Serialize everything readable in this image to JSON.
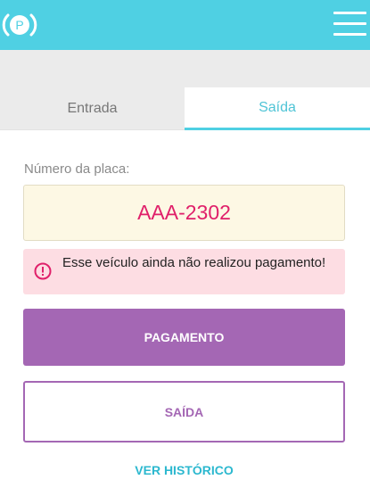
{
  "header": {
    "logo_icon": "parking-logo-icon",
    "logo_letter": "P",
    "menu_icon": "hamburger-menu-icon",
    "background_color": "#4fd0e3"
  },
  "tabs": [
    {
      "label": "Entrada",
      "active": false
    },
    {
      "label": "Saída",
      "active": true
    }
  ],
  "form": {
    "plate_label": "Número da placa:",
    "plate_value": "AAA-2302"
  },
  "alert": {
    "icon": "alert-circle-icon",
    "message": "Esse veículo ainda não realizou pagamento!",
    "color": "#e0206a"
  },
  "buttons": {
    "pagamento_label": "PAGAMENTO",
    "saida_label": "SAÍDA",
    "historico_label": "VER HISTÓRICO"
  },
  "colors": {
    "accent": "#4fd0e3",
    "primary_button": "#a467b4",
    "plate_text": "#e0206a",
    "link": "#2cb8cf"
  }
}
